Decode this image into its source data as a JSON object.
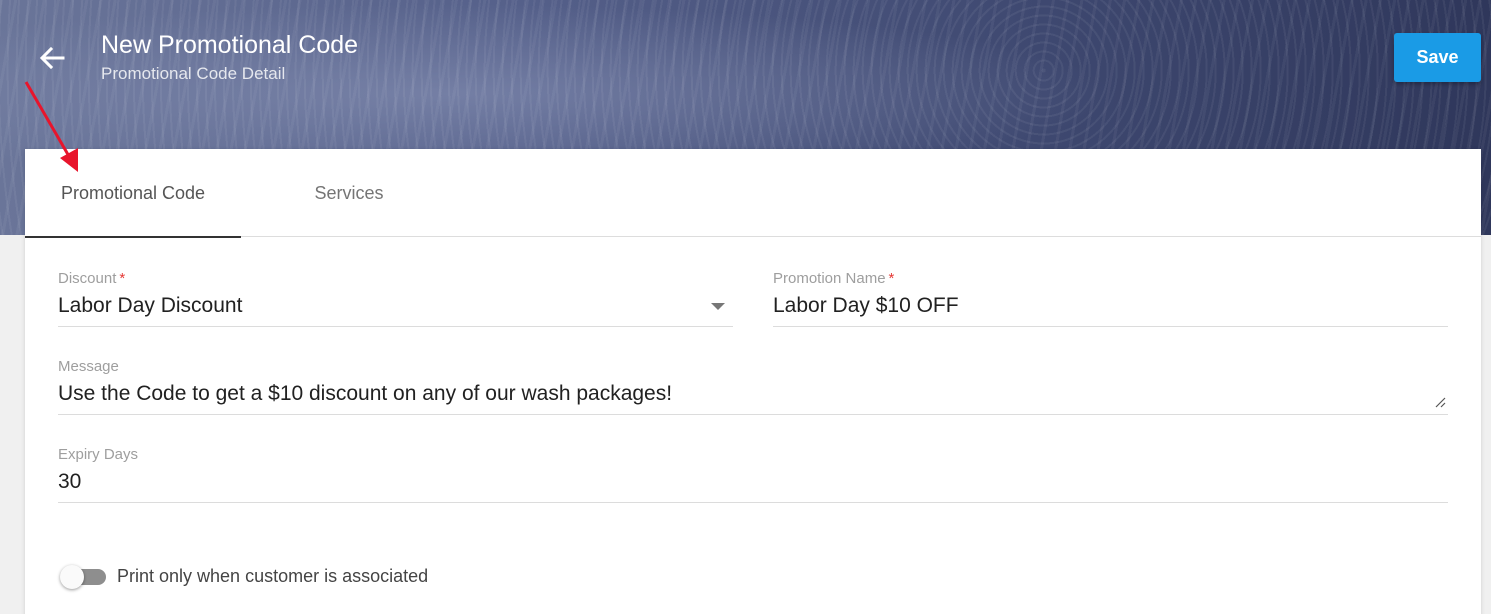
{
  "header": {
    "title": "New Promotional Code",
    "subtitle": "Promotional Code Detail",
    "save_label": "Save",
    "back_icon": "arrow-left-icon"
  },
  "annotation": {
    "icon": "red-arrow-annotation",
    "color": "#e8152c"
  },
  "tabs": [
    {
      "label": "Promotional Code",
      "active": true
    },
    {
      "label": "Services",
      "active": false
    }
  ],
  "form": {
    "discount": {
      "label": "Discount",
      "required": "*",
      "value": "Labor Day Discount"
    },
    "promotion_name": {
      "label": "Promotion Name",
      "required": "*",
      "value": "Labor Day $10 OFF"
    },
    "message": {
      "label": "Message",
      "value": "Use the Code to get a $10 discount on any of our wash packages!"
    },
    "expiry_days": {
      "label": "Expiry Days",
      "value": "30"
    },
    "print_toggle": {
      "label": "Print only when customer is associated",
      "on": false
    }
  },
  "colors": {
    "accent": "#1a9be6",
    "required": "#e53935"
  }
}
